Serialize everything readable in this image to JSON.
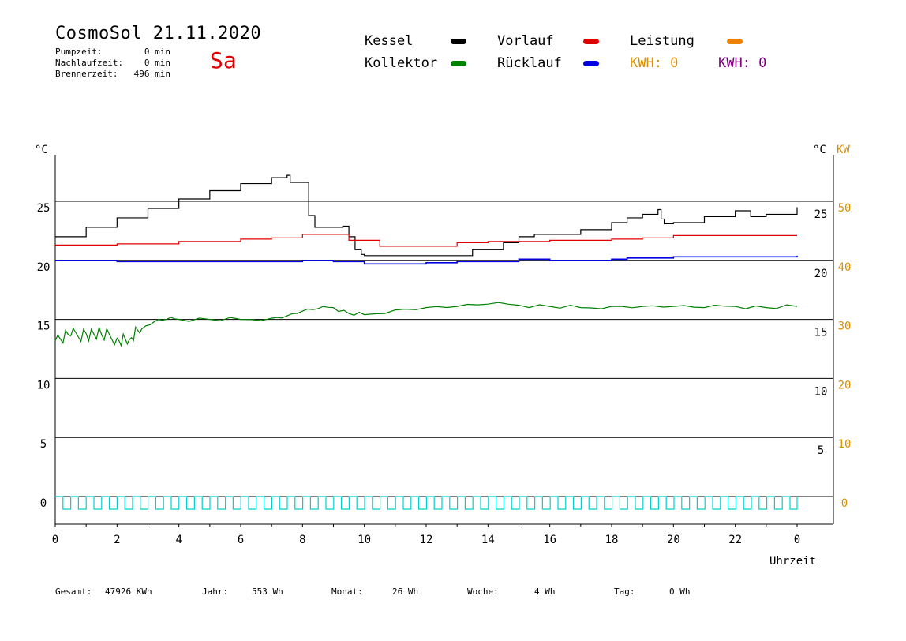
{
  "header": {
    "title": "CosmoSol 21.11.2020",
    "day": "Sa",
    "stats": [
      {
        "label": "Pumpzeit:",
        "value": "0 min"
      },
      {
        "label": "Nachlaufzeit:",
        "value": "0 min"
      },
      {
        "label": "Brennerzeit:",
        "value": "496 min"
      }
    ]
  },
  "legend": {
    "items": [
      {
        "label": "Kessel",
        "color": "#000000"
      },
      {
        "label": "Vorlauf",
        "color": "#e00000"
      },
      {
        "label": "Leistung",
        "color": "#f08000"
      },
      {
        "label": "Kollektor",
        "color": "#008000"
      },
      {
        "label": "Rücklauf",
        "color": "#0000e0"
      }
    ],
    "kwh": [
      {
        "text": "KWH: 0",
        "color": "#d89000"
      },
      {
        "text": "KWH: 0",
        "color": "#800080"
      }
    ]
  },
  "footer": [
    {
      "label": "Gesamt:",
      "value": "47926 KWh"
    },
    {
      "label": "Jahr:",
      "value": "553 Wh"
    },
    {
      "label": "Monat:",
      "value": "26 Wh"
    },
    {
      "label": "Woche:",
      "value": "4 Wh"
    },
    {
      "label": "Tag:",
      "value": "0 Wh"
    }
  ],
  "chart_data": {
    "type": "line",
    "xlabel": "Uhrzeit",
    "x_ticks": [
      "0",
      "2",
      "4",
      "6",
      "8",
      "10",
      "12",
      "14",
      "16",
      "18",
      "20",
      "22",
      "0"
    ],
    "xlim": [
      0,
      24
    ],
    "ylim": [
      -2.5,
      30
    ],
    "y_left_unit": "°C",
    "y_left_ticks": [
      0,
      5,
      10,
      15,
      20,
      25
    ],
    "y_right_unit": "°C",
    "y_right_ticks": [
      5,
      10,
      15,
      20,
      25
    ],
    "y_right2_unit": "KW",
    "y_right2_ticks": [
      0,
      10,
      20,
      30,
      40,
      50
    ],
    "y_right2_color": "#d89000",
    "grid": "horizontal",
    "series": [
      {
        "name": "Kessel",
        "color": "#000000",
        "x": [
          0,
          1,
          2,
          3,
          4,
          5,
          6,
          7,
          7.5,
          7.6,
          8.1,
          8.2,
          8.4,
          9.0,
          9.3,
          9.5,
          9.7,
          9.9,
          10.0,
          11,
          12,
          12.8,
          13.5,
          14.5,
          15,
          15.5,
          16,
          17,
          18,
          18.5,
          19,
          19.5,
          19.6,
          19.7,
          20,
          21,
          22,
          22.5,
          23,
          24
        ],
        "y": [
          22.0,
          22.8,
          23.6,
          24.4,
          25.2,
          25.9,
          26.5,
          27.0,
          27.2,
          26.6,
          26.6,
          23.8,
          22.8,
          22.8,
          22.9,
          22.0,
          20.9,
          20.5,
          20.4,
          20.4,
          20.4,
          20.4,
          20.9,
          21.5,
          22.0,
          22.2,
          22.2,
          22.6,
          23.2,
          23.6,
          23.9,
          24.3,
          23.5,
          23.1,
          23.2,
          23.7,
          24.2,
          23.7,
          23.9,
          24.5
        ]
      },
      {
        "name": "Vorlauf",
        "color": "#e00000",
        "x": [
          0,
          2,
          4,
          6,
          7,
          8,
          9,
          9.5,
          10.5,
          12,
          13,
          14,
          16,
          18,
          19,
          20,
          22,
          24
        ],
        "y": [
          21.3,
          21.4,
          21.6,
          21.8,
          21.9,
          22.2,
          22.2,
          21.7,
          21.2,
          21.2,
          21.5,
          21.6,
          21.7,
          21.8,
          21.9,
          22.1,
          22.1,
          22.1
        ]
      },
      {
        "name": "Rücklauf",
        "color": "#0000e0",
        "x": [
          0,
          2,
          4,
          6,
          8,
          9,
          10,
          11,
          12,
          13,
          15,
          16,
          18,
          18.5,
          20,
          22,
          24
        ],
        "y": [
          20.0,
          19.9,
          19.9,
          19.9,
          20.0,
          19.9,
          19.7,
          19.7,
          19.8,
          19.9,
          20.1,
          20.0,
          20.1,
          20.2,
          20.3,
          20.3,
          20.4
        ]
      },
      {
        "name": "Kollektor",
        "color": "#008000",
        "x": [
          0,
          0.5,
          1,
          1.5,
          2,
          2.4,
          2.8,
          3.2,
          3.6,
          4,
          5,
          6,
          7,
          7.5,
          8,
          8.5,
          9,
          9.5,
          10,
          11,
          12,
          13,
          14,
          15,
          16,
          17,
          18,
          19,
          20,
          21,
          22,
          23,
          24
        ],
        "y": [
          13.2,
          13.6,
          13.8,
          13.7,
          13.4,
          13.3,
          14.2,
          14.8,
          15.0,
          15.0,
          15.0,
          15.0,
          15.1,
          15.3,
          15.7,
          15.9,
          16.0,
          15.5,
          15.4,
          15.8,
          16.0,
          16.1,
          16.3,
          16.2,
          16.1,
          16.0,
          16.1,
          16.1,
          16.1,
          16.0,
          16.1,
          16.0,
          16.1
        ]
      },
      {
        "name": "Leistung",
        "color": "#f08000",
        "x": [],
        "y": []
      }
    ],
    "pump_signal": {
      "color": "#00d0d0",
      "level": 0,
      "low": -1
    }
  }
}
